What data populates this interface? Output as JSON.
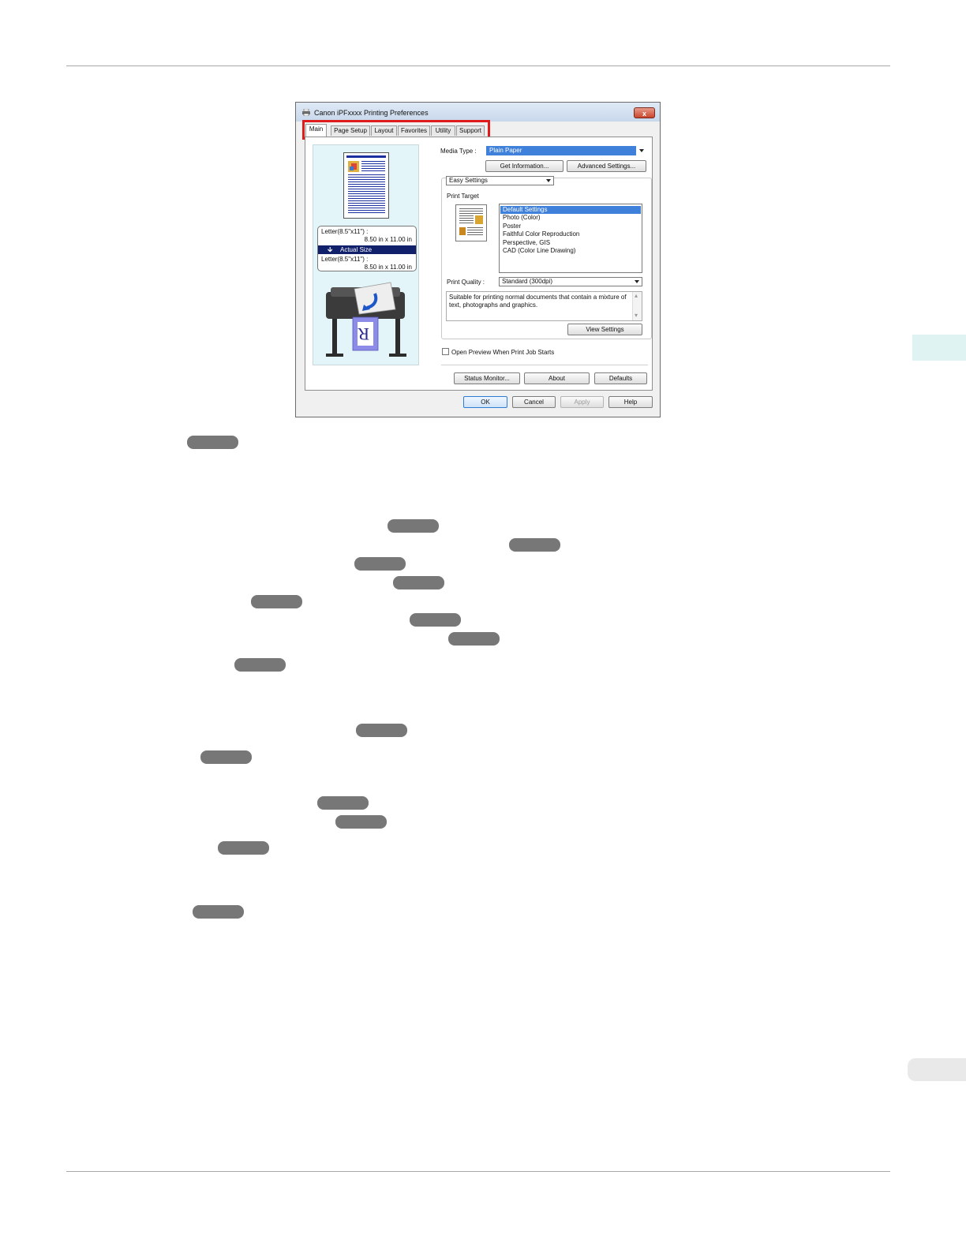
{
  "dialog": {
    "title": "Canon iPFxxxx Printing Preferences",
    "close_glyph": "x",
    "tabs": [
      {
        "label": "Main"
      },
      {
        "label": "Page Setup"
      },
      {
        "label": "Layout"
      },
      {
        "label": "Favorites"
      },
      {
        "label": "Utility"
      },
      {
        "label": "Support"
      }
    ],
    "preview": {
      "original_size": "Letter(8.5\"x11\") :",
      "original_dims": "8.50 in x 11.00 in",
      "scaling": "Actual Size",
      "output_size": "Letter(8.5\"x11\") :",
      "output_dims": "8.50 in x 11.00 in"
    },
    "media_type_label": "Media Type :",
    "media_type_value": "Plain Paper",
    "get_information_button": "Get Information...",
    "advanced_settings_button": "Advanced Settings...",
    "mode_value": "Easy Settings",
    "print_target_label": "Print Target",
    "print_targets": [
      {
        "label": "Default Settings",
        "selected": true
      },
      {
        "label": "Photo (Color)",
        "selected": false
      },
      {
        "label": "Poster",
        "selected": false
      },
      {
        "label": "Faithful Color Reproduction",
        "selected": false
      },
      {
        "label": "Perspective, GIS",
        "selected": false
      },
      {
        "label": "CAD (Color Line Drawing)",
        "selected": false
      }
    ],
    "print_quality_label": "Print Quality :",
    "print_quality_value": "Standard (300dpi)",
    "description_line1": "Suitable for printing normal documents that contain a mixture of",
    "description_line2": "text, photographs and graphics.",
    "scroll_up_glyph": "▴",
    "scroll_down_glyph": "▾",
    "view_settings_button": "View Settings",
    "open_preview_label": "Open Preview When Print Job Starts",
    "status_monitor_button": "Status Monitor...",
    "about_button": "About",
    "defaults_button": "Defaults",
    "ok_button": "OK",
    "cancel_button": "Cancel",
    "apply_button": "Apply",
    "help_button": "Help"
  },
  "colors": {
    "tab_highlight": "#e01b1b",
    "selection": "#3f80db",
    "scaling_bar": "#10206b",
    "page_side_tab": "#dff3f3",
    "reference_pill": "#777777"
  },
  "icons": [
    "printer-icon",
    "close-icon",
    "down-arrow-icon",
    "dropdown-arrow-icon",
    "checkbox-icon"
  ]
}
